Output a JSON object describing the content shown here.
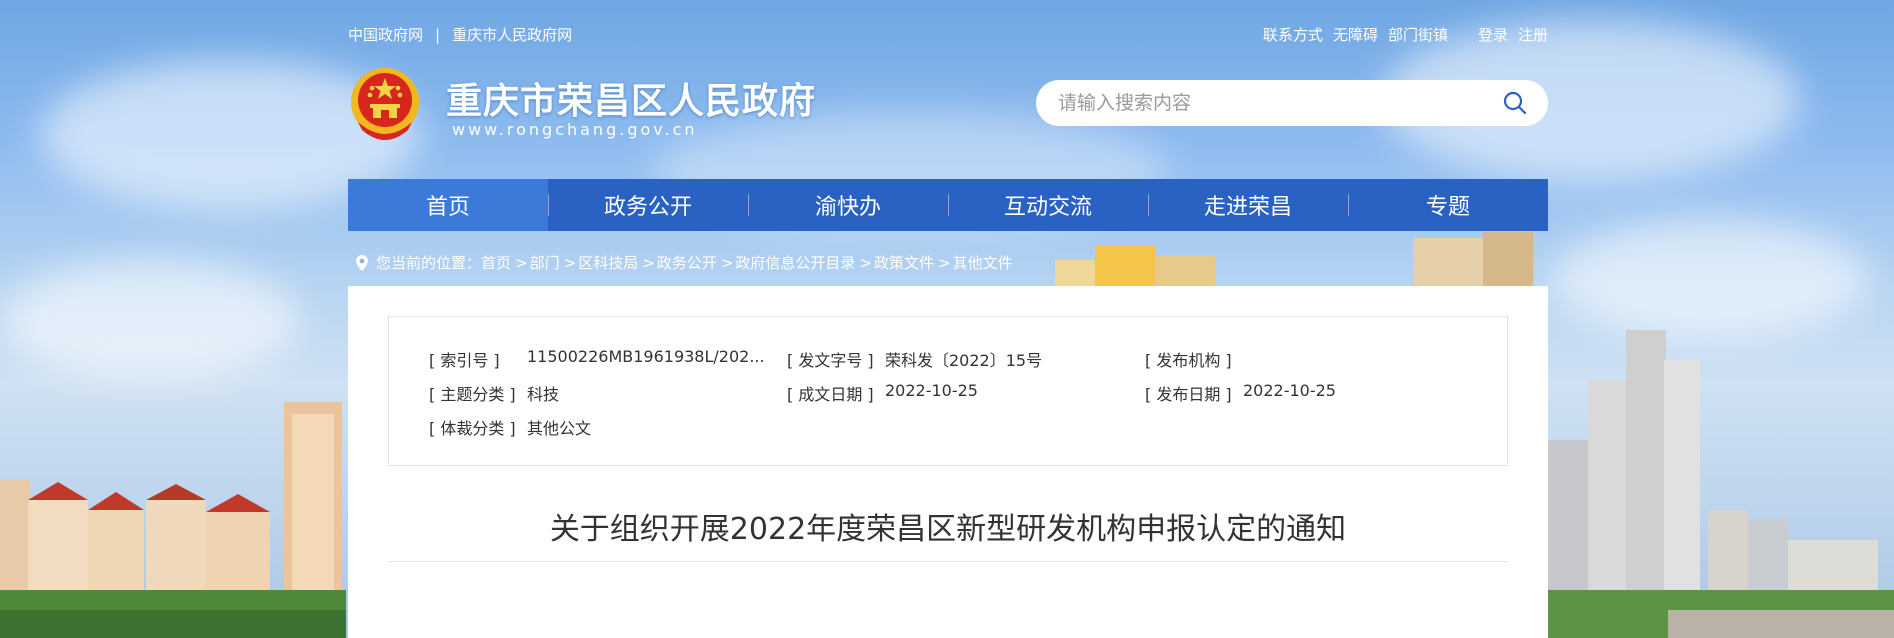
{
  "top_links": {
    "gov_cn": "中国政府网",
    "separator": "|",
    "cq_gov": "重庆市人民政府网"
  },
  "right_links": {
    "contact": "联系方式",
    "accessibility": "无障碍",
    "departments": "部门街镇",
    "login": "登录",
    "register": "注册"
  },
  "site": {
    "title": "重庆市荣昌区人民政府",
    "url": "www.rongchang.gov.cn"
  },
  "search": {
    "placeholder": "请输入搜索内容",
    "icon": "search-icon"
  },
  "nav": {
    "items": [
      "首页",
      "政务公开",
      "渝快办",
      "互动交流",
      "走进荣昌",
      "专题"
    ],
    "active_index": 0
  },
  "breadcrumb": {
    "prefix": "您当前的位置：",
    "items": [
      "首页",
      "部门",
      "区科技局",
      "政务公开",
      "政府信息公开目录",
      "政策文件",
      "其他文件"
    ],
    "separator": ">"
  },
  "meta": {
    "index_no_label": "[ 索引号 ]",
    "index_no": "11500226MB1961938L/202...",
    "doc_no_label": "[ 发文字号 ]",
    "doc_no": "荣科发〔2022〕15号",
    "publisher_label": "[ 发布机构 ]",
    "publisher": "",
    "topic_label": "[ 主题分类 ]",
    "topic": "科技",
    "written_date_label": "[ 成文日期 ]",
    "written_date": "2022-10-25",
    "publish_date_label": "[ 发布日期 ]",
    "publish_date": "2022-10-25",
    "genre_label": "[ 体裁分类 ]",
    "genre": "其他公文"
  },
  "document": {
    "title": "关于组织开展2022年度荣昌区新型研发机构申报认定的通知"
  },
  "colors": {
    "nav_bg": "#2a62c4",
    "nav_active": "#3b7ad9",
    "emblem_red": "#d7261c",
    "emblem_gold": "#f2b81d"
  }
}
